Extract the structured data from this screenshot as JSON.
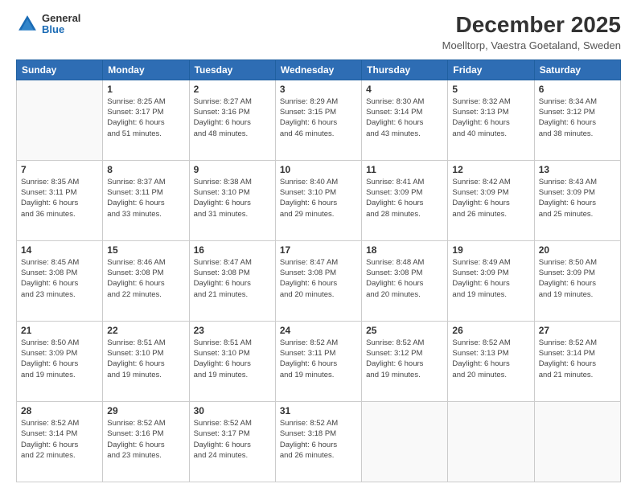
{
  "logo": {
    "general": "General",
    "blue": "Blue"
  },
  "title": "December 2025",
  "location": "Moelltorp, Vaestra Goetaland, Sweden",
  "days_header": [
    "Sunday",
    "Monday",
    "Tuesday",
    "Wednesday",
    "Thursday",
    "Friday",
    "Saturday"
  ],
  "weeks": [
    [
      {
        "day": "",
        "info": ""
      },
      {
        "day": "1",
        "info": "Sunrise: 8:25 AM\nSunset: 3:17 PM\nDaylight: 6 hours\nand 51 minutes."
      },
      {
        "day": "2",
        "info": "Sunrise: 8:27 AM\nSunset: 3:16 PM\nDaylight: 6 hours\nand 48 minutes."
      },
      {
        "day": "3",
        "info": "Sunrise: 8:29 AM\nSunset: 3:15 PM\nDaylight: 6 hours\nand 46 minutes."
      },
      {
        "day": "4",
        "info": "Sunrise: 8:30 AM\nSunset: 3:14 PM\nDaylight: 6 hours\nand 43 minutes."
      },
      {
        "day": "5",
        "info": "Sunrise: 8:32 AM\nSunset: 3:13 PM\nDaylight: 6 hours\nand 40 minutes."
      },
      {
        "day": "6",
        "info": "Sunrise: 8:34 AM\nSunset: 3:12 PM\nDaylight: 6 hours\nand 38 minutes."
      }
    ],
    [
      {
        "day": "7",
        "info": "Sunrise: 8:35 AM\nSunset: 3:11 PM\nDaylight: 6 hours\nand 36 minutes."
      },
      {
        "day": "8",
        "info": "Sunrise: 8:37 AM\nSunset: 3:11 PM\nDaylight: 6 hours\nand 33 minutes."
      },
      {
        "day": "9",
        "info": "Sunrise: 8:38 AM\nSunset: 3:10 PM\nDaylight: 6 hours\nand 31 minutes."
      },
      {
        "day": "10",
        "info": "Sunrise: 8:40 AM\nSunset: 3:10 PM\nDaylight: 6 hours\nand 29 minutes."
      },
      {
        "day": "11",
        "info": "Sunrise: 8:41 AM\nSunset: 3:09 PM\nDaylight: 6 hours\nand 28 minutes."
      },
      {
        "day": "12",
        "info": "Sunrise: 8:42 AM\nSunset: 3:09 PM\nDaylight: 6 hours\nand 26 minutes."
      },
      {
        "day": "13",
        "info": "Sunrise: 8:43 AM\nSunset: 3:09 PM\nDaylight: 6 hours\nand 25 minutes."
      }
    ],
    [
      {
        "day": "14",
        "info": "Sunrise: 8:45 AM\nSunset: 3:08 PM\nDaylight: 6 hours\nand 23 minutes."
      },
      {
        "day": "15",
        "info": "Sunrise: 8:46 AM\nSunset: 3:08 PM\nDaylight: 6 hours\nand 22 minutes."
      },
      {
        "day": "16",
        "info": "Sunrise: 8:47 AM\nSunset: 3:08 PM\nDaylight: 6 hours\nand 21 minutes."
      },
      {
        "day": "17",
        "info": "Sunrise: 8:47 AM\nSunset: 3:08 PM\nDaylight: 6 hours\nand 20 minutes."
      },
      {
        "day": "18",
        "info": "Sunrise: 8:48 AM\nSunset: 3:08 PM\nDaylight: 6 hours\nand 20 minutes."
      },
      {
        "day": "19",
        "info": "Sunrise: 8:49 AM\nSunset: 3:09 PM\nDaylight: 6 hours\nand 19 minutes."
      },
      {
        "day": "20",
        "info": "Sunrise: 8:50 AM\nSunset: 3:09 PM\nDaylight: 6 hours\nand 19 minutes."
      }
    ],
    [
      {
        "day": "21",
        "info": "Sunrise: 8:50 AM\nSunset: 3:09 PM\nDaylight: 6 hours\nand 19 minutes."
      },
      {
        "day": "22",
        "info": "Sunrise: 8:51 AM\nSunset: 3:10 PM\nDaylight: 6 hours\nand 19 minutes."
      },
      {
        "day": "23",
        "info": "Sunrise: 8:51 AM\nSunset: 3:10 PM\nDaylight: 6 hours\nand 19 minutes."
      },
      {
        "day": "24",
        "info": "Sunrise: 8:52 AM\nSunset: 3:11 PM\nDaylight: 6 hours\nand 19 minutes."
      },
      {
        "day": "25",
        "info": "Sunrise: 8:52 AM\nSunset: 3:12 PM\nDaylight: 6 hours\nand 19 minutes."
      },
      {
        "day": "26",
        "info": "Sunrise: 8:52 AM\nSunset: 3:13 PM\nDaylight: 6 hours\nand 20 minutes."
      },
      {
        "day": "27",
        "info": "Sunrise: 8:52 AM\nSunset: 3:14 PM\nDaylight: 6 hours\nand 21 minutes."
      }
    ],
    [
      {
        "day": "28",
        "info": "Sunrise: 8:52 AM\nSunset: 3:14 PM\nDaylight: 6 hours\nand 22 minutes."
      },
      {
        "day": "29",
        "info": "Sunrise: 8:52 AM\nSunset: 3:16 PM\nDaylight: 6 hours\nand 23 minutes."
      },
      {
        "day": "30",
        "info": "Sunrise: 8:52 AM\nSunset: 3:17 PM\nDaylight: 6 hours\nand 24 minutes."
      },
      {
        "day": "31",
        "info": "Sunrise: 8:52 AM\nSunset: 3:18 PM\nDaylight: 6 hours\nand 26 minutes."
      },
      {
        "day": "",
        "info": ""
      },
      {
        "day": "",
        "info": ""
      },
      {
        "day": "",
        "info": ""
      }
    ]
  ]
}
